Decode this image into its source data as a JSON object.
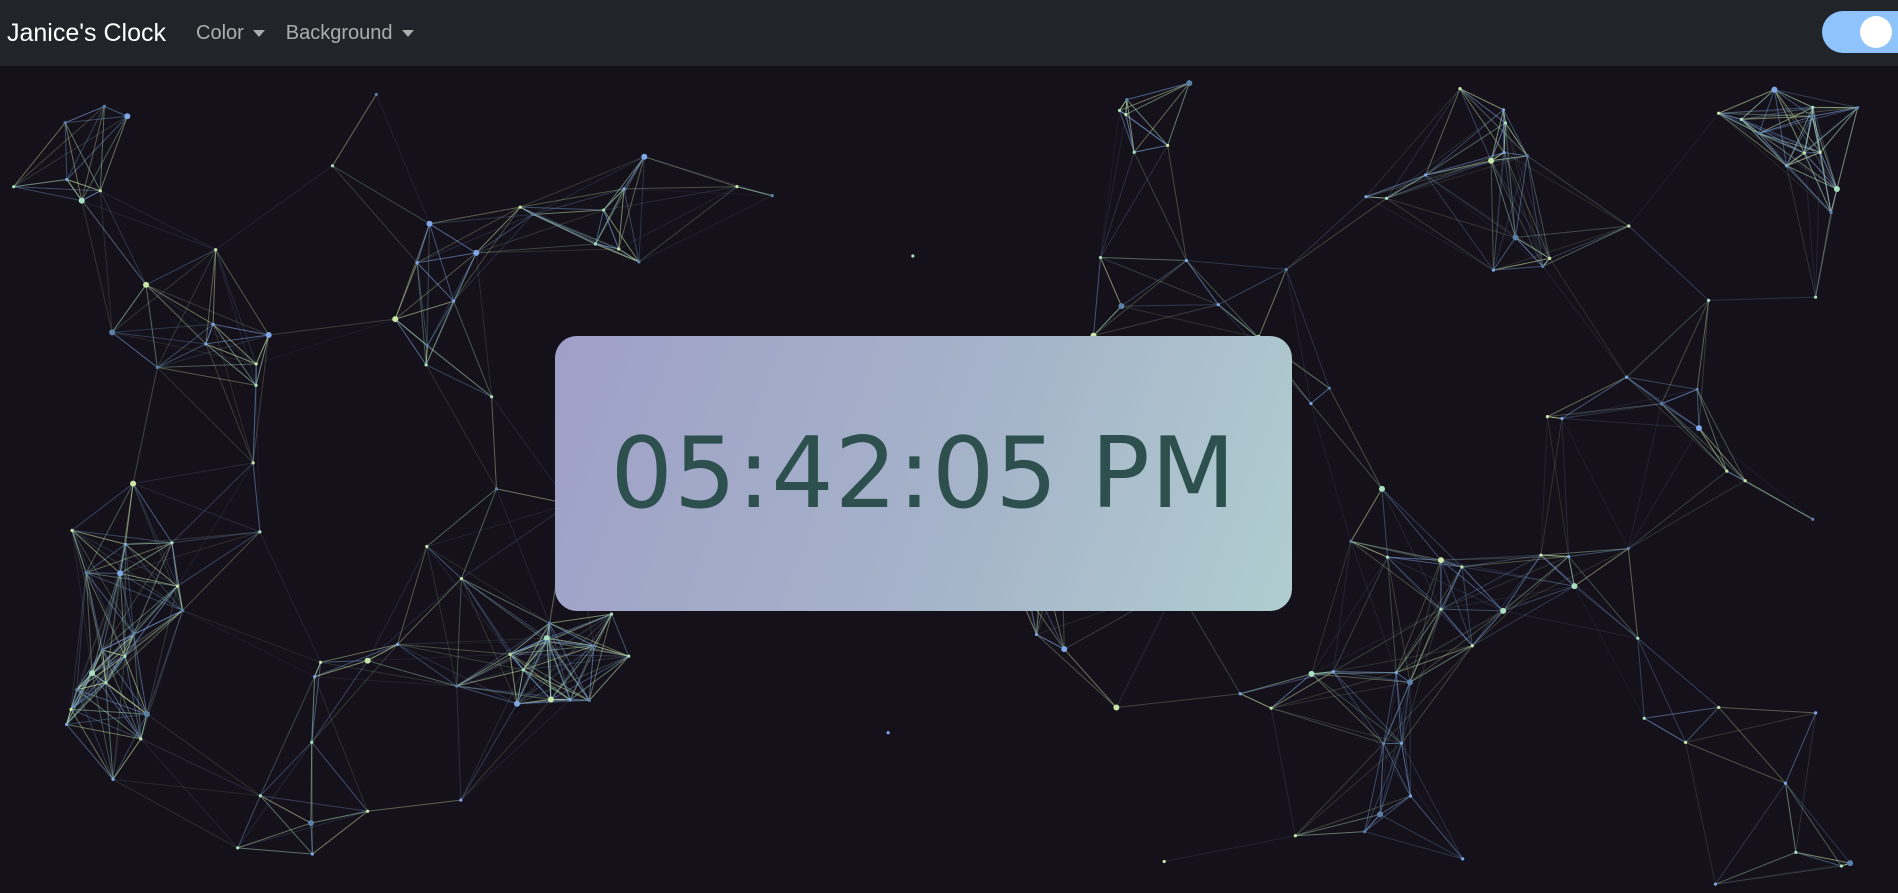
{
  "app": {
    "title": "Janice's Clock"
  },
  "nav": {
    "items": [
      {
        "label": "Color"
      },
      {
        "label": "Background"
      }
    ]
  },
  "theme_toggle": {
    "state": "on",
    "accent_color": "#8fc3fb"
  },
  "clock": {
    "time": "05:42:05 PM",
    "text_color": "#2d4f4e",
    "card_gradient": [
      "#9fa0c8",
      "#b0cdd0"
    ]
  },
  "background": {
    "style": "particle-network",
    "base_color": "#15111a",
    "line_colors": [
      "#7fa6e6",
      "#a9e0bf",
      "#5c7fa8",
      "#c9e5a8"
    ]
  }
}
